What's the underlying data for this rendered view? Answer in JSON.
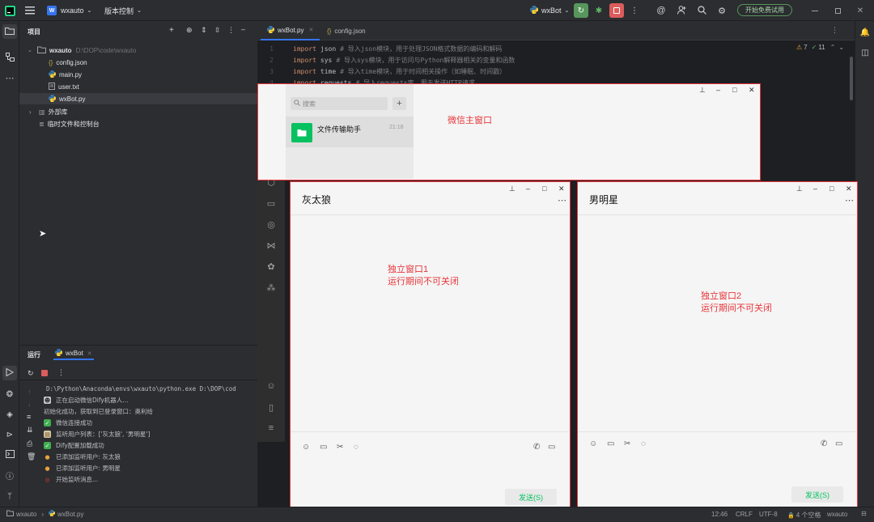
{
  "titlebar": {
    "project_badge": "W",
    "project_name": "wxauto",
    "vcs_label": "版本控制",
    "run_config": "wxBot",
    "trial_button": "开始免费试用"
  },
  "project_panel": {
    "header": "项目",
    "root_name": "wxauto",
    "root_path": "D:\\DOP\\code\\wxauto",
    "files": [
      {
        "name": "config.json",
        "icon": "json-file-icon"
      },
      {
        "name": "main.py",
        "icon": "python-file-icon"
      },
      {
        "name": "user.txt",
        "icon": "text-file-icon"
      },
      {
        "name": "wxBot.py",
        "icon": "python-file-icon"
      }
    ],
    "external_libs": "外部库",
    "scratches": "临时文件和控制台"
  },
  "editor": {
    "tabs": [
      {
        "name": "wxBot.py",
        "active": true
      },
      {
        "name": "config.json",
        "active": false
      }
    ],
    "inspections": {
      "warnings": "7",
      "ok": "11"
    },
    "lines": [
      {
        "num": "1",
        "kw": "import",
        "id": "json",
        "comment": "# 导入json模块，用于处理JSON格式数据的编码和解码"
      },
      {
        "num": "2",
        "kw": "import",
        "id": "sys",
        "comment": "# 导入sys模块，用于访问与Python解释器相关的变量和函数"
      },
      {
        "num": "3",
        "kw": "import",
        "id": "time",
        "comment": "# 导入time模块，用于时间相关操作（如睡眠、时间戳）"
      },
      {
        "num": "4",
        "kw": "import",
        "id": "requests",
        "comment": "# 导入requests库，用于发送HTTP请求"
      }
    ]
  },
  "run_panel": {
    "header": "运行",
    "tab": "wxBot",
    "command": "D:\\Python\\Anaconda\\envs\\wxauto\\python.exe D:\\DOP\\cod",
    "logs": [
      {
        "text": "正在启动微信Dify机器人...",
        "icon": "robot-icon"
      },
      {
        "text": "初始化成功，获取到已登录窗口：奥利给",
        "icon": ""
      },
      {
        "text": "微信连接成功",
        "icon": "check-icon"
      },
      {
        "text": "监听用户列表：['灰太狼', '男明星']",
        "icon": "clipboard-icon"
      },
      {
        "text": "Dify配置加载成功",
        "icon": "check-icon"
      },
      {
        "text": "已添加监听用户: 灰太狼",
        "icon": "pin-icon"
      },
      {
        "text": "已添加监听用户: 男明星",
        "icon": "pin-icon"
      },
      {
        "text": "开始监听消息...",
        "icon": "target-icon"
      }
    ]
  },
  "statusbar": {
    "project": "wxauto",
    "file": "wxBot.py",
    "position": "12:46",
    "line_sep": "CRLF",
    "encoding": "UTF-8",
    "indent": "4 个空格",
    "interpreter": "wxauto"
  },
  "wechat_main": {
    "search_placeholder": "搜索",
    "chat_name": "文件传输助手",
    "chat_time": "21:18",
    "annotation": "微信主窗口"
  },
  "chat_window_1": {
    "title": "灰太狼",
    "annotation_line1": "独立窗口1",
    "annotation_line2": "运行期间不可关闭",
    "send_label": "发送(S)"
  },
  "chat_window_2": {
    "title": "男明星",
    "annotation_line1": "独立窗口2",
    "annotation_line2": "运行期间不可关闭",
    "send_label": "发送(S)"
  },
  "colors": {
    "annotation_red": "#e8363b",
    "wechat_green": "#07c160",
    "ide_bg": "#1e1f22",
    "ide_panel": "#2b2d30"
  }
}
